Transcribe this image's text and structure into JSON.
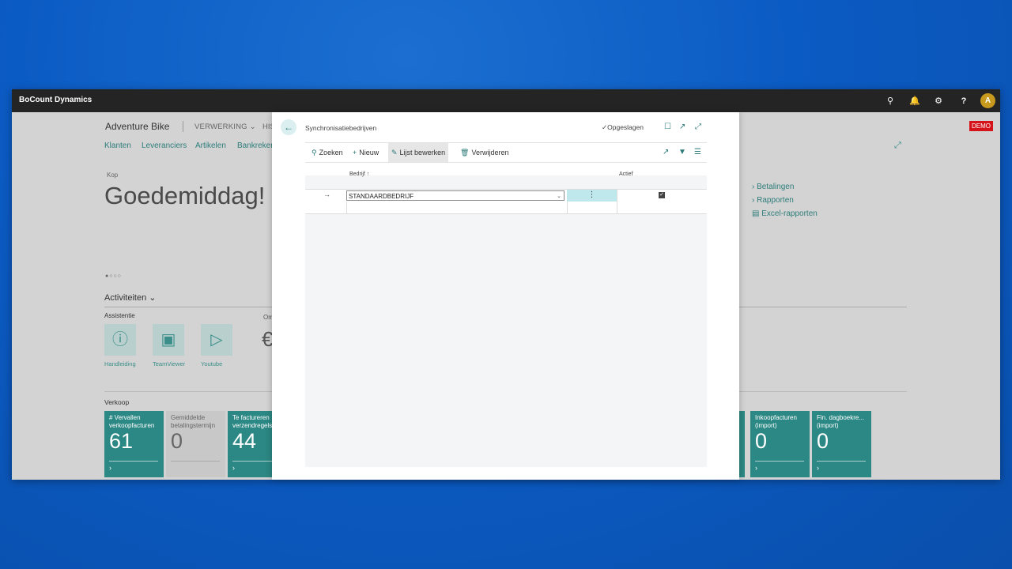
{
  "app": {
    "brand": "BoCount Dynamics",
    "avatar": "A"
  },
  "topbar_icons": [
    "search-icon",
    "bell-icon",
    "gear-icon",
    "help-icon"
  ],
  "rolecenter": {
    "company": "Adventure Bike",
    "menu1": "VERWERKING",
    "menu2": "HIS",
    "demo": "DEMO",
    "nav": [
      "Klanten",
      "Leveranciers",
      "Artikelen",
      "Bankreken"
    ],
    "kop": "Kop",
    "greeting": "Goedemiddag!",
    "right_links": [
      "Betalingen",
      "Rapporten",
      "Excel-rapporten"
    ],
    "activities": "Activiteiten",
    "assist_title": "Assistentie",
    "om_label": "Om",
    "assist_tiles": [
      "Handleiding",
      "TeamViewer",
      "Youtube"
    ],
    "sales_title": "Verkoop",
    "tiles": [
      {
        "line1": "# Vervallen",
        "line2": "verkoopfacturen",
        "value": "61",
        "style": "teal"
      },
      {
        "line1": "Gemiddelde",
        "line2": "betalingstermijn",
        "value": "0",
        "style": "grey"
      },
      {
        "line1": "Te factureren",
        "line2": "verzendregels",
        "value": "44",
        "style": "teal"
      },
      {
        "line1": "Inkoopfacturen",
        "line2": "(import)",
        "value": "0",
        "style": "teal"
      },
      {
        "line1": "Fin. dagboekre...",
        "line2": "(import)",
        "value": "0",
        "style": "teal"
      }
    ]
  },
  "dialog": {
    "title": "Synchronisatiebedrijven",
    "saved": "Opgeslagen",
    "actions": {
      "search": "Zoeken",
      "new": "Nieuw",
      "edit_list": "Lijst bewerken",
      "delete": "Verwijderen"
    },
    "columns": {
      "company": "Bedrijf",
      "active": "Actief"
    },
    "rows": [
      {
        "company": "STANDAARDBEDRIJF",
        "active": true
      }
    ]
  }
}
